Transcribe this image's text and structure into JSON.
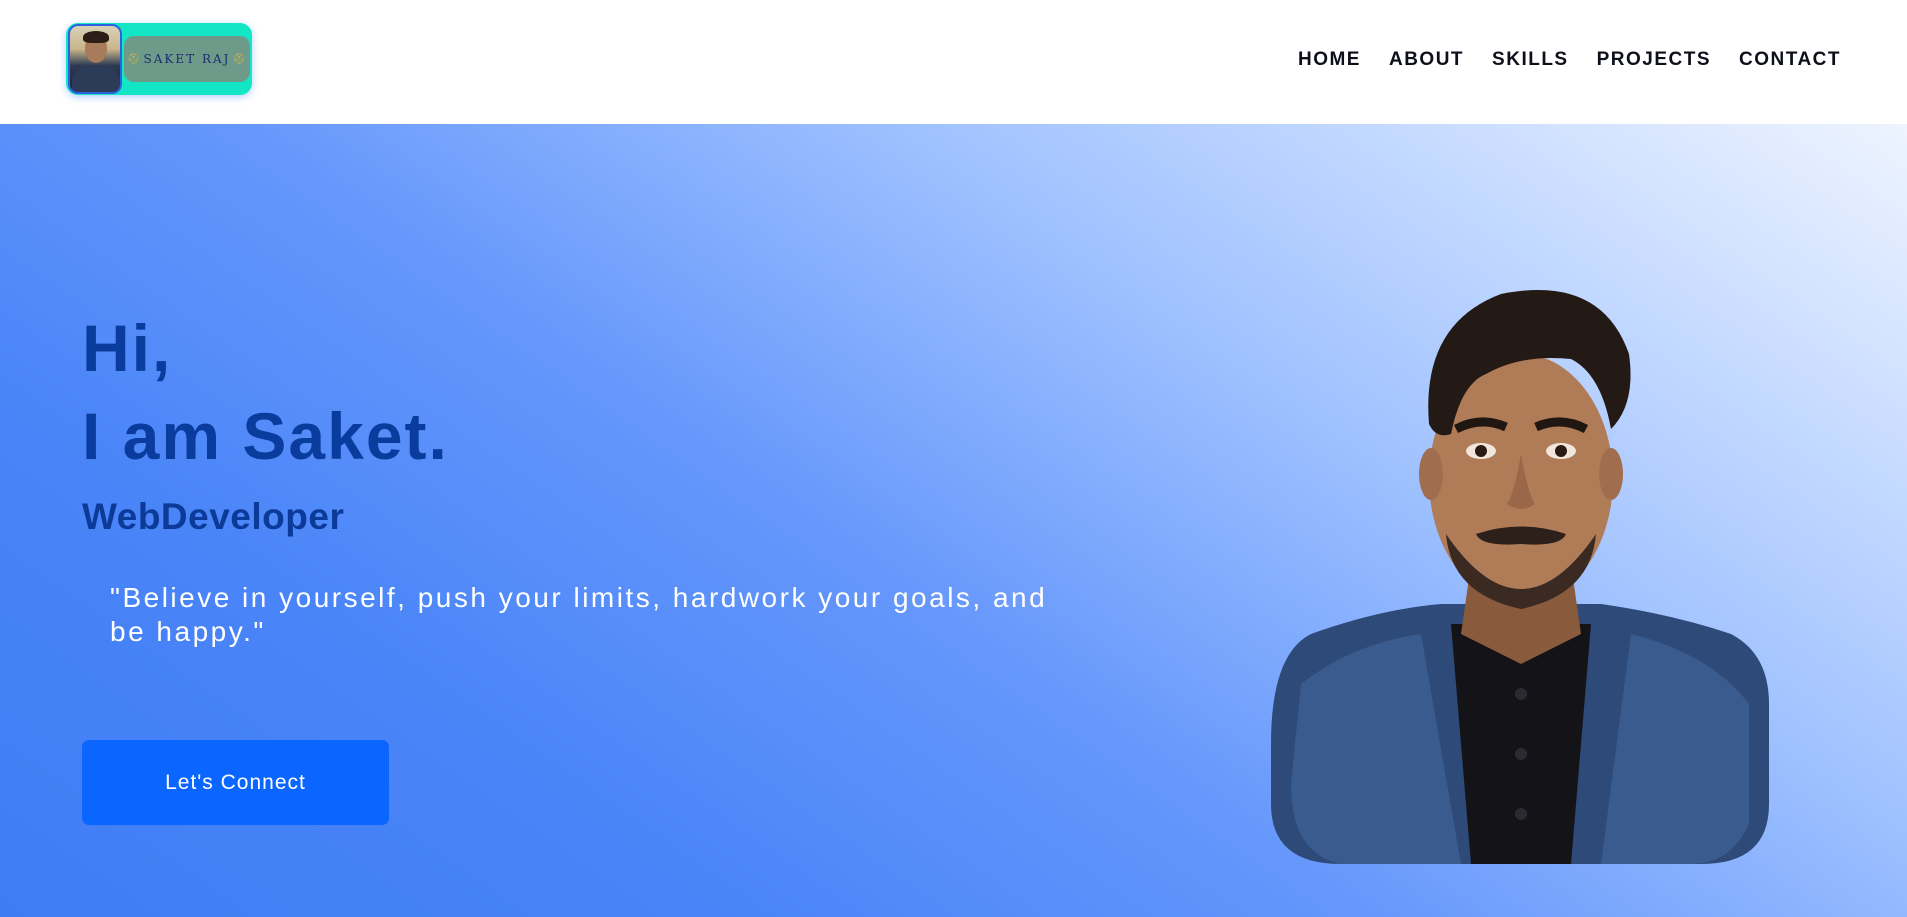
{
  "header": {
    "logo": {
      "name_text": "SAKET RAJ",
      "glyph": "⛑"
    },
    "nav": [
      {
        "label": "HOME"
      },
      {
        "label": "ABOUT"
      },
      {
        "label": "SKILLS"
      },
      {
        "label": "PROJECTS"
      },
      {
        "label": "CONTACT"
      }
    ]
  },
  "hero": {
    "greeting_line1": "Hi,",
    "greeting_line2": "I am Saket.",
    "role": "WebDeveloper",
    "quote": "\"Believe in yourself, push your limits, hardwork your goals, and be happy.\"",
    "cta_label": "Let's Connect"
  },
  "colors": {
    "accent": "#0a66ff",
    "heading": "#0a3c9e",
    "logo_bg": "#12e6c4"
  }
}
